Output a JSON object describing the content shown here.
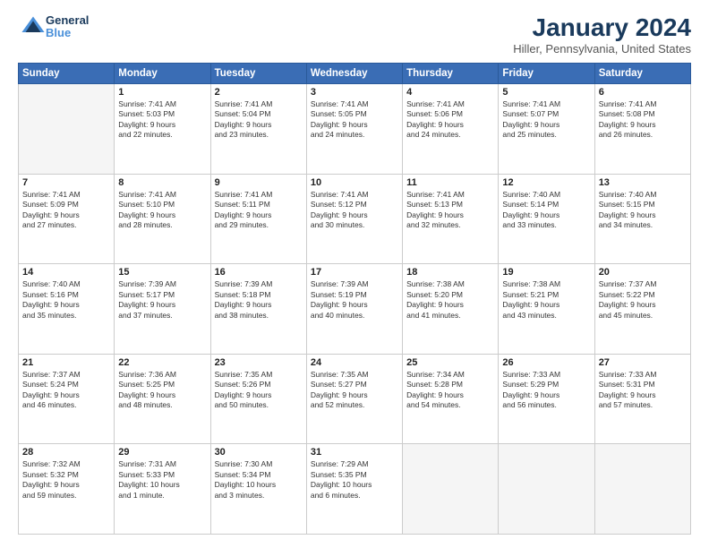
{
  "logo": {
    "text_general": "General",
    "text_blue": "Blue"
  },
  "title": "January 2024",
  "location": "Hiller, Pennsylvania, United States",
  "headers": [
    "Sunday",
    "Monday",
    "Tuesday",
    "Wednesday",
    "Thursday",
    "Friday",
    "Saturday"
  ],
  "weeks": [
    [
      {
        "day": "",
        "content": ""
      },
      {
        "day": "1",
        "content": "Sunrise: 7:41 AM\nSunset: 5:03 PM\nDaylight: 9 hours\nand 22 minutes."
      },
      {
        "day": "2",
        "content": "Sunrise: 7:41 AM\nSunset: 5:04 PM\nDaylight: 9 hours\nand 23 minutes."
      },
      {
        "day": "3",
        "content": "Sunrise: 7:41 AM\nSunset: 5:05 PM\nDaylight: 9 hours\nand 24 minutes."
      },
      {
        "day": "4",
        "content": "Sunrise: 7:41 AM\nSunset: 5:06 PM\nDaylight: 9 hours\nand 24 minutes."
      },
      {
        "day": "5",
        "content": "Sunrise: 7:41 AM\nSunset: 5:07 PM\nDaylight: 9 hours\nand 25 minutes."
      },
      {
        "day": "6",
        "content": "Sunrise: 7:41 AM\nSunset: 5:08 PM\nDaylight: 9 hours\nand 26 minutes."
      }
    ],
    [
      {
        "day": "7",
        "content": "Sunrise: 7:41 AM\nSunset: 5:09 PM\nDaylight: 9 hours\nand 27 minutes."
      },
      {
        "day": "8",
        "content": "Sunrise: 7:41 AM\nSunset: 5:10 PM\nDaylight: 9 hours\nand 28 minutes."
      },
      {
        "day": "9",
        "content": "Sunrise: 7:41 AM\nSunset: 5:11 PM\nDaylight: 9 hours\nand 29 minutes."
      },
      {
        "day": "10",
        "content": "Sunrise: 7:41 AM\nSunset: 5:12 PM\nDaylight: 9 hours\nand 30 minutes."
      },
      {
        "day": "11",
        "content": "Sunrise: 7:41 AM\nSunset: 5:13 PM\nDaylight: 9 hours\nand 32 minutes."
      },
      {
        "day": "12",
        "content": "Sunrise: 7:40 AM\nSunset: 5:14 PM\nDaylight: 9 hours\nand 33 minutes."
      },
      {
        "day": "13",
        "content": "Sunrise: 7:40 AM\nSunset: 5:15 PM\nDaylight: 9 hours\nand 34 minutes."
      }
    ],
    [
      {
        "day": "14",
        "content": "Sunrise: 7:40 AM\nSunset: 5:16 PM\nDaylight: 9 hours\nand 35 minutes."
      },
      {
        "day": "15",
        "content": "Sunrise: 7:39 AM\nSunset: 5:17 PM\nDaylight: 9 hours\nand 37 minutes."
      },
      {
        "day": "16",
        "content": "Sunrise: 7:39 AM\nSunset: 5:18 PM\nDaylight: 9 hours\nand 38 minutes."
      },
      {
        "day": "17",
        "content": "Sunrise: 7:39 AM\nSunset: 5:19 PM\nDaylight: 9 hours\nand 40 minutes."
      },
      {
        "day": "18",
        "content": "Sunrise: 7:38 AM\nSunset: 5:20 PM\nDaylight: 9 hours\nand 41 minutes."
      },
      {
        "day": "19",
        "content": "Sunrise: 7:38 AM\nSunset: 5:21 PM\nDaylight: 9 hours\nand 43 minutes."
      },
      {
        "day": "20",
        "content": "Sunrise: 7:37 AM\nSunset: 5:22 PM\nDaylight: 9 hours\nand 45 minutes."
      }
    ],
    [
      {
        "day": "21",
        "content": "Sunrise: 7:37 AM\nSunset: 5:24 PM\nDaylight: 9 hours\nand 46 minutes."
      },
      {
        "day": "22",
        "content": "Sunrise: 7:36 AM\nSunset: 5:25 PM\nDaylight: 9 hours\nand 48 minutes."
      },
      {
        "day": "23",
        "content": "Sunrise: 7:35 AM\nSunset: 5:26 PM\nDaylight: 9 hours\nand 50 minutes."
      },
      {
        "day": "24",
        "content": "Sunrise: 7:35 AM\nSunset: 5:27 PM\nDaylight: 9 hours\nand 52 minutes."
      },
      {
        "day": "25",
        "content": "Sunrise: 7:34 AM\nSunset: 5:28 PM\nDaylight: 9 hours\nand 54 minutes."
      },
      {
        "day": "26",
        "content": "Sunrise: 7:33 AM\nSunset: 5:29 PM\nDaylight: 9 hours\nand 56 minutes."
      },
      {
        "day": "27",
        "content": "Sunrise: 7:33 AM\nSunset: 5:31 PM\nDaylight: 9 hours\nand 57 minutes."
      }
    ],
    [
      {
        "day": "28",
        "content": "Sunrise: 7:32 AM\nSunset: 5:32 PM\nDaylight: 9 hours\nand 59 minutes."
      },
      {
        "day": "29",
        "content": "Sunrise: 7:31 AM\nSunset: 5:33 PM\nDaylight: 10 hours\nand 1 minute."
      },
      {
        "day": "30",
        "content": "Sunrise: 7:30 AM\nSunset: 5:34 PM\nDaylight: 10 hours\nand 3 minutes."
      },
      {
        "day": "31",
        "content": "Sunrise: 7:29 AM\nSunset: 5:35 PM\nDaylight: 10 hours\nand 6 minutes."
      },
      {
        "day": "",
        "content": ""
      },
      {
        "day": "",
        "content": ""
      },
      {
        "day": "",
        "content": ""
      }
    ]
  ]
}
